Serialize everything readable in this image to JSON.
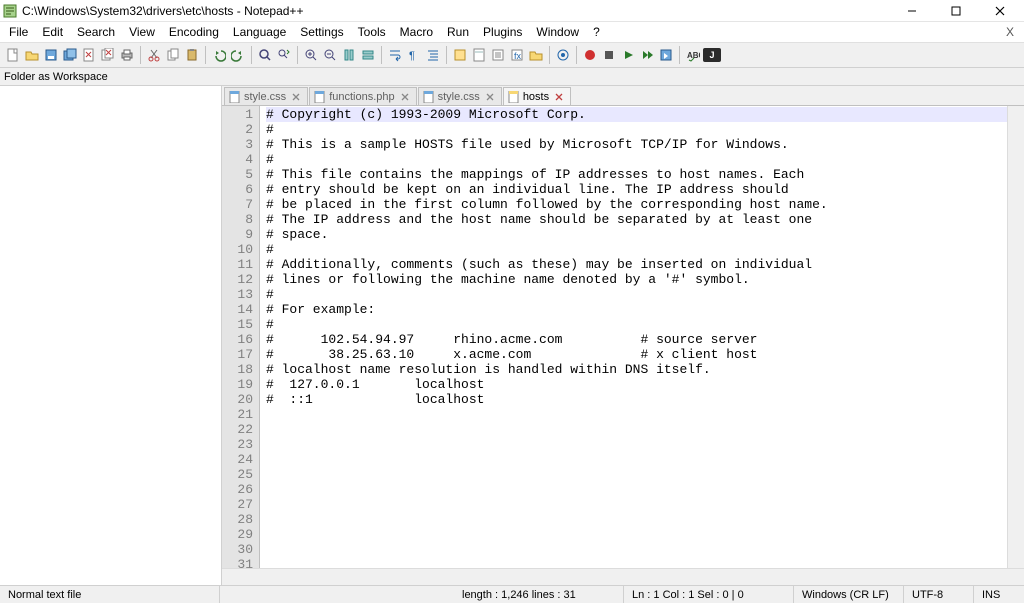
{
  "window": {
    "title": "C:\\Windows\\System32\\drivers\\etc\\hosts - Notepad++"
  },
  "menu": [
    "File",
    "Edit",
    "Search",
    "View",
    "Encoding",
    "Language",
    "Settings",
    "Tools",
    "Macro",
    "Run",
    "Plugins",
    "Window",
    "?"
  ],
  "workspace_panel": {
    "title": "Folder as Workspace"
  },
  "tabs": [
    {
      "label": "style.css",
      "active": false,
      "saved": true
    },
    {
      "label": "functions.php",
      "active": false,
      "saved": true
    },
    {
      "label": "style.css",
      "active": false,
      "saved": true
    },
    {
      "label": "hosts",
      "active": true,
      "saved": true
    }
  ],
  "editor": {
    "total_lines": 31,
    "content": [
      "# Copyright (c) 1993-2009 Microsoft Corp.",
      "#",
      "# This is a sample HOSTS file used by Microsoft TCP/IP for Windows.",
      "#",
      "# This file contains the mappings of IP addresses to host names. Each",
      "# entry should be kept on an individual line. The IP address should",
      "# be placed in the first column followed by the corresponding host name.",
      "# The IP address and the host name should be separated by at least one",
      "# space.",
      "#",
      "# Additionally, comments (such as these) may be inserted on individual",
      "# lines or following the machine name denoted by a '#' symbol.",
      "#",
      "# For example:",
      "#",
      "#      102.54.94.97     rhino.acme.com          # source server",
      "#       38.25.63.10     x.acme.com              # x client host",
      "# localhost name resolution is handled within DNS itself.",
      "#  127.0.0.1       localhost",
      "#  ::1             localhost"
    ]
  },
  "status": {
    "file_type": "Normal text file",
    "length_label": "length : 1,246    lines : 31",
    "pos_label": "Ln : 1    Col : 1    Sel : 0 | 0",
    "eol": "Windows (CR LF)",
    "encoding": "UTF-8",
    "mode": "INS"
  },
  "toolbar_icons": [
    "new-file-icon",
    "open-file-icon",
    "save-icon",
    "save-all-icon",
    "close-icon",
    "close-all-icon",
    "print-icon",
    "sep",
    "cut-icon",
    "copy-icon",
    "paste-icon",
    "sep",
    "undo-icon",
    "redo-icon",
    "sep",
    "find-icon",
    "replace-icon",
    "sep",
    "zoom-in-icon",
    "zoom-out-icon",
    "sync-v-icon",
    "sync-h-icon",
    "sep",
    "word-wrap-icon",
    "show-all-chars-icon",
    "indent-guide-icon",
    "sep",
    "lang-udl-icon",
    "doc-map-icon",
    "doc-list-icon",
    "func-list-icon",
    "folder-ws-icon",
    "sep",
    "monitoring-icon",
    "sep",
    "record-macro-icon",
    "stop-macro-icon",
    "play-macro-icon",
    "play-multi-icon",
    "save-macro-icon",
    "sep",
    "spellcheck-icon",
    "dark-badge"
  ]
}
